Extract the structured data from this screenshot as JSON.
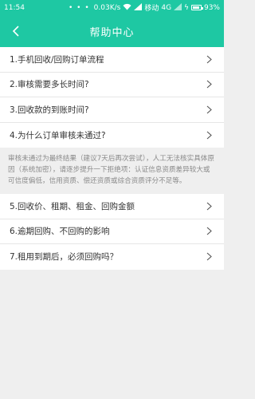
{
  "status_bar": {
    "time": "11:54",
    "dots": "• • •",
    "speed": "0.03K/s",
    "carrier": "移动",
    "network": "4G",
    "battery_percent": "93%",
    "battery_level": 0.93
  },
  "navbar": {
    "title": "帮助中心"
  },
  "faq_top": [
    {
      "label": "1.手机回收/回购订单流程"
    },
    {
      "label": "2.审核需要多长时间?"
    },
    {
      "label": "3.回收款的到账时间?"
    },
    {
      "label": "4.为什么订单审核未通过?"
    }
  ],
  "answer": "审核未通过为最终结果（建议7天后再次尝试），人工无法核实具体原因（系统加密），请逐步提升一下拒绝项：认证信息资质差异较大或可信度偏低，信用资质、偿还资质或综合资质评分不足等。",
  "faq_bottom": [
    {
      "label": "5.回收价、租期、租金、回购金额"
    },
    {
      "label": "6.逾期回购、不回购的影响"
    },
    {
      "label": "7.租用到期后，必须回购吗？"
    }
  ],
  "colors": {
    "accent": "#1ec8a3",
    "background": "#efefef"
  }
}
